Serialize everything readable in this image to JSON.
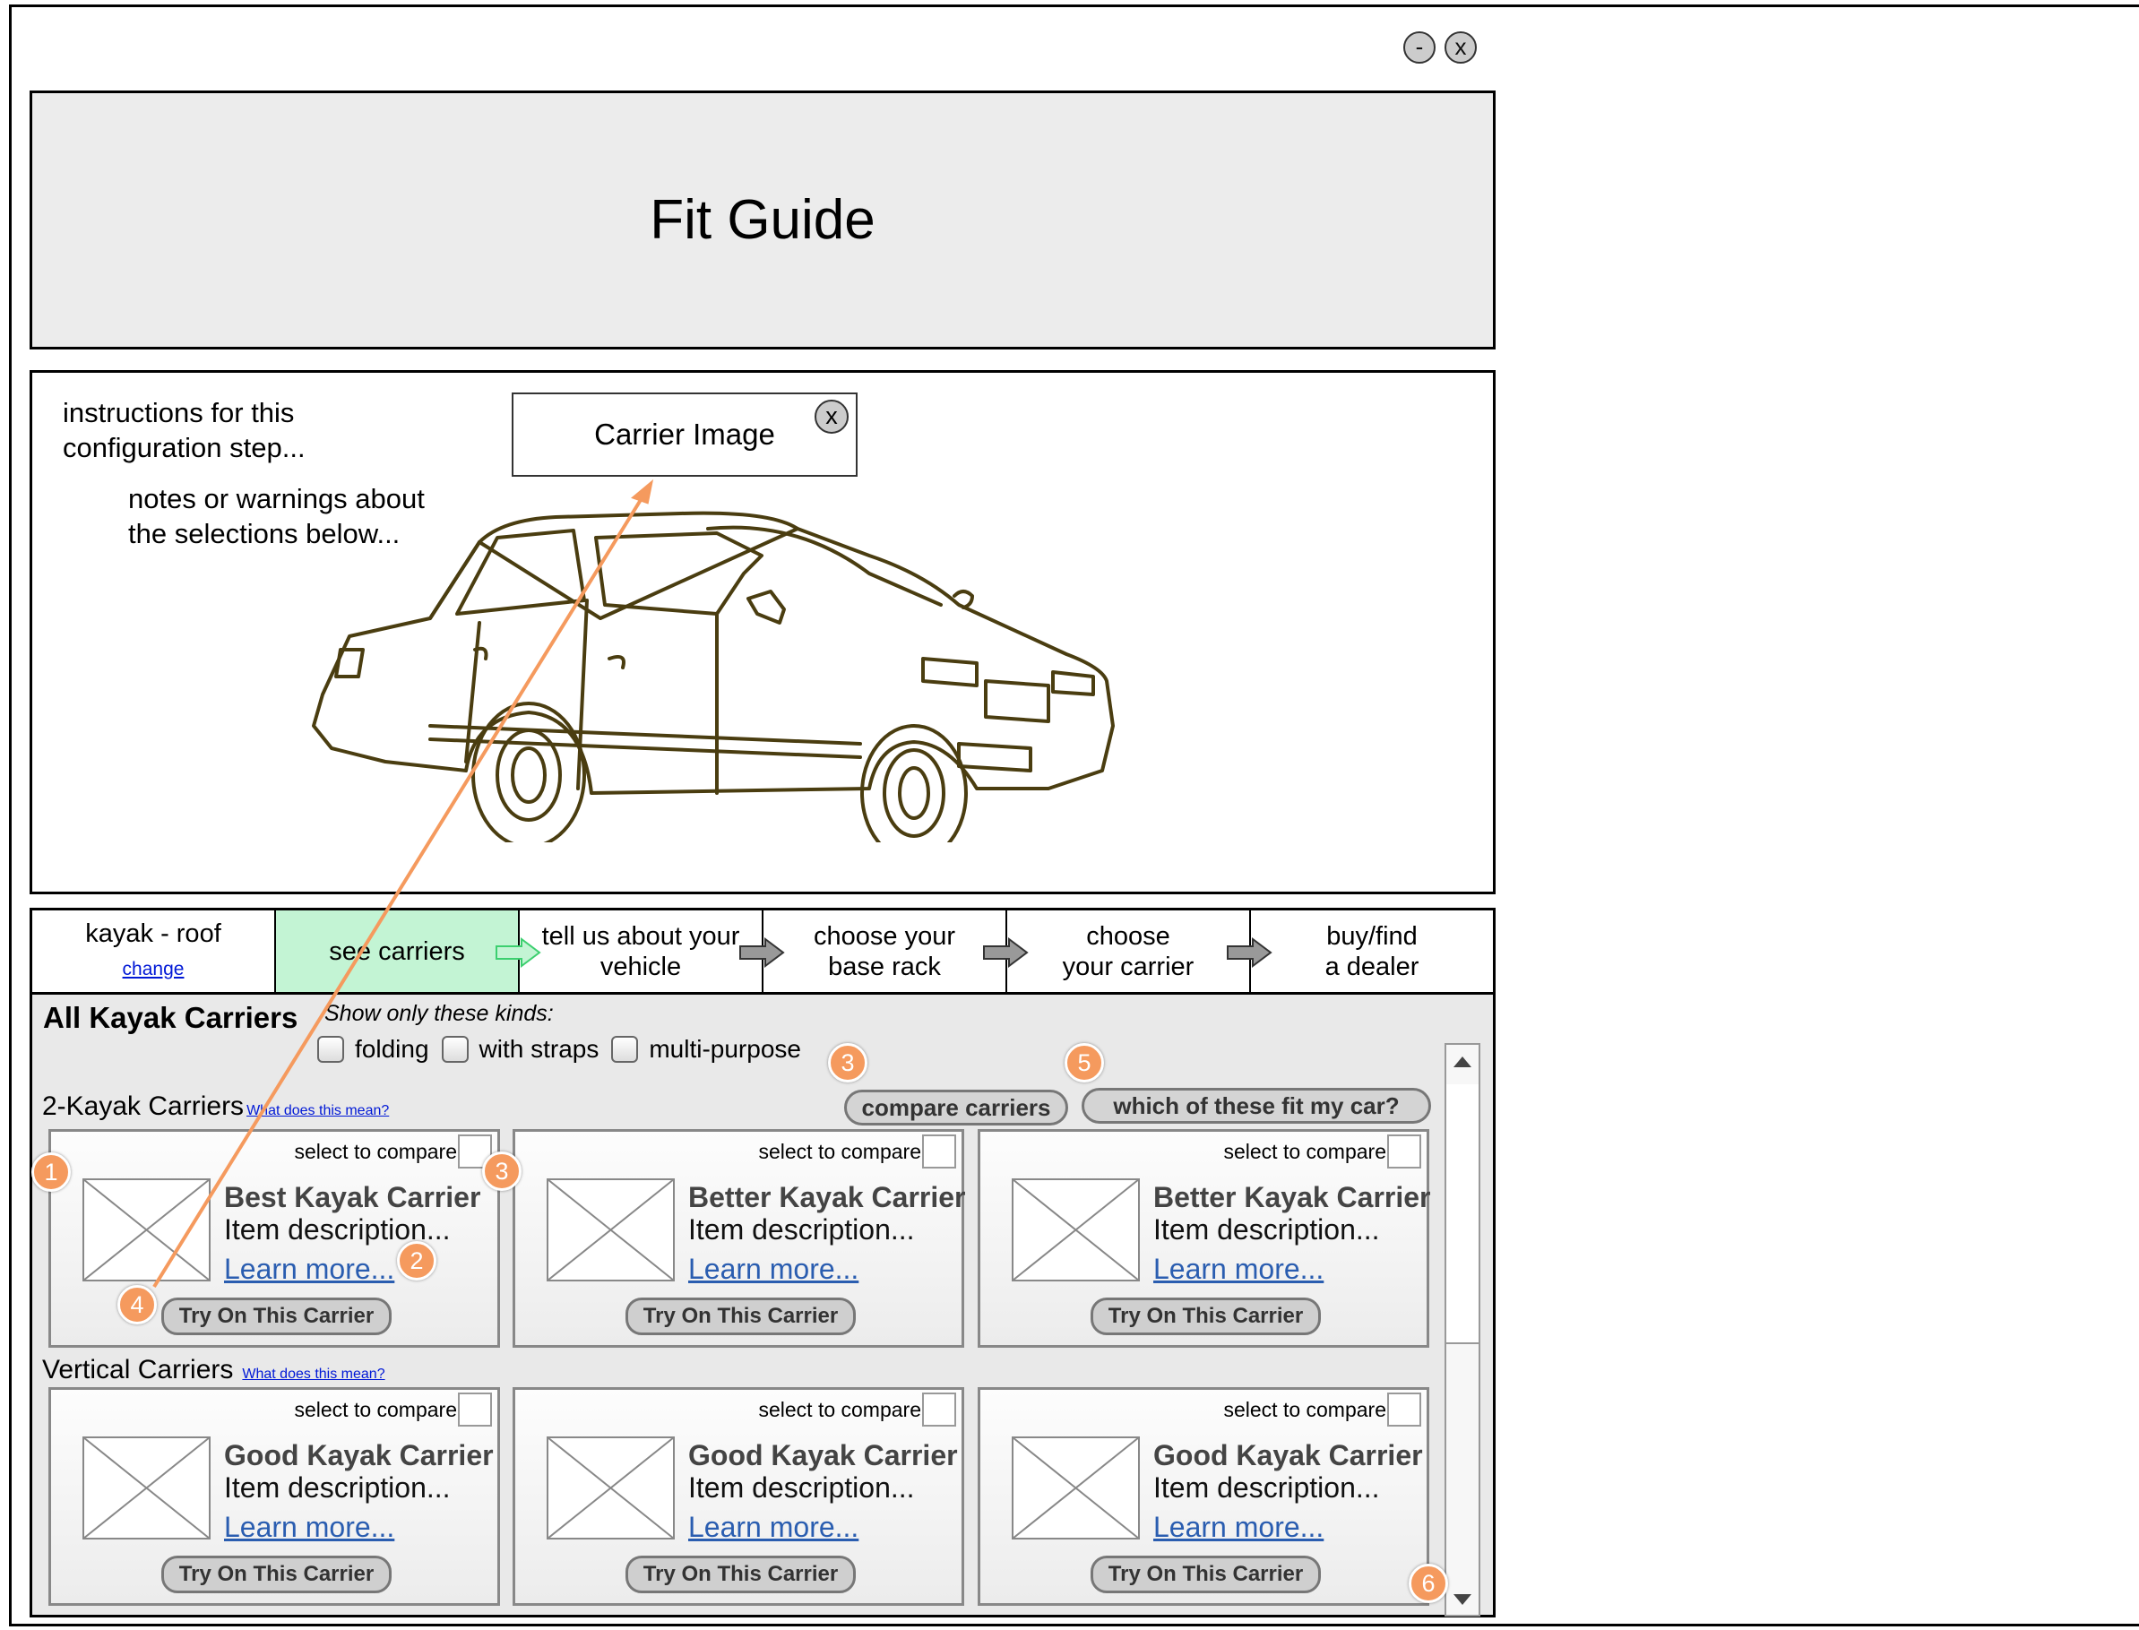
{
  "window": {
    "minimize_label": "-",
    "close_label": "x"
  },
  "header": {
    "title": "Fit Guide"
  },
  "image_panel": {
    "instructions": [
      "instructions for this",
      "configuration step..."
    ],
    "notes": [
      "notes or warnings about",
      "the selections below..."
    ],
    "carrier_image_label": "Carrier Image",
    "carrier_image_close": "x"
  },
  "steps": {
    "step1_label": "kayak - roof",
    "step1_link": "change",
    "step2_label": "see carriers",
    "step3_label": [
      "tell us about your",
      "vehicle"
    ],
    "step4_label": [
      "choose your",
      "base rack"
    ],
    "step5_label": [
      "choose",
      "your carrier"
    ],
    "step6_label": [
      "buy/find",
      "a dealer"
    ]
  },
  "content": {
    "title": "All Kayak Carriers",
    "filter_label": "Show only these kinds:",
    "filters": [
      "folding",
      "with straps",
      "multi-purpose"
    ],
    "compare_button": "compare carriers",
    "fit_button": "which of these fit my car?",
    "sections": [
      {
        "label": "2-Kayak Carriers",
        "help_link": "What does this mean?",
        "cards": [
          {
            "title": "Best Kayak Carrier",
            "desc": "Item description...",
            "link": "Learn more...",
            "select": "select to compare",
            "button": "Try On This Carrier"
          },
          {
            "title": "Better Kayak Carrier",
            "desc": "Item description...",
            "link": "Learn more...",
            "select": "select to compare",
            "button": "Try On This Carrier"
          },
          {
            "title": "Better Kayak Carrier",
            "desc": "Item description...",
            "link": "Learn more...",
            "select": "select to compare",
            "button": "Try On This Carrier"
          }
        ]
      },
      {
        "label": "Vertical Carriers",
        "help_link": "What does this mean?",
        "cards": [
          {
            "title": "Good Kayak Carrier",
            "desc": "Item description...",
            "link": "Learn more...",
            "select": "select to compare",
            "button": "Try On This Carrier"
          },
          {
            "title": "Good Kayak Carrier",
            "desc": "Item description...",
            "link": "Learn more...",
            "select": "select to compare",
            "button": "Try On This Carrier"
          },
          {
            "title": "Good Kayak Carrier",
            "desc": "Item description...",
            "link": "Learn more...",
            "select": "select to compare",
            "button": "Try On This Carrier"
          }
        ]
      }
    ]
  },
  "annotations": {
    "badge1": "1",
    "badge2": "2",
    "badge3a": "3",
    "badge3b": "3",
    "badge4": "4",
    "badge5": "5",
    "badge6": "6",
    "color": "#f59a5e"
  },
  "colors": {
    "active_step": "#c3f4d4",
    "link": "#0018d6",
    "learn_more": "#2a5db0"
  }
}
